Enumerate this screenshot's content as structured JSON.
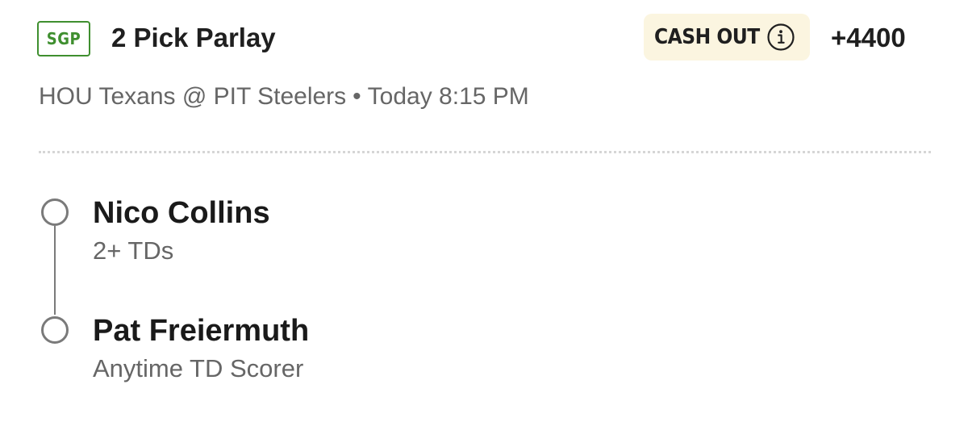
{
  "bet": {
    "badge": "SGP",
    "title": "2 Pick Parlay",
    "cashout_label": "CASH OUT",
    "odds": "+4400",
    "matchup": "HOU Texans @ PIT Steelers",
    "separator": "•",
    "start_time": "Today 8:15 PM"
  },
  "legs": [
    {
      "player": "Nico Collins",
      "market": "2+ TDs",
      "icon": "status-circle-icon"
    },
    {
      "player": "Pat Freiermuth",
      "market": "Anytime TD Scorer",
      "icon": "status-circle-icon"
    }
  ],
  "colors": {
    "sgp_green": "#3f8f2f",
    "cashout_bg": "#fbf5e0",
    "secondary_text": "#666666",
    "timeline_gray": "#7a7a7a"
  },
  "icons": {
    "cashout_info": "info-icon"
  }
}
